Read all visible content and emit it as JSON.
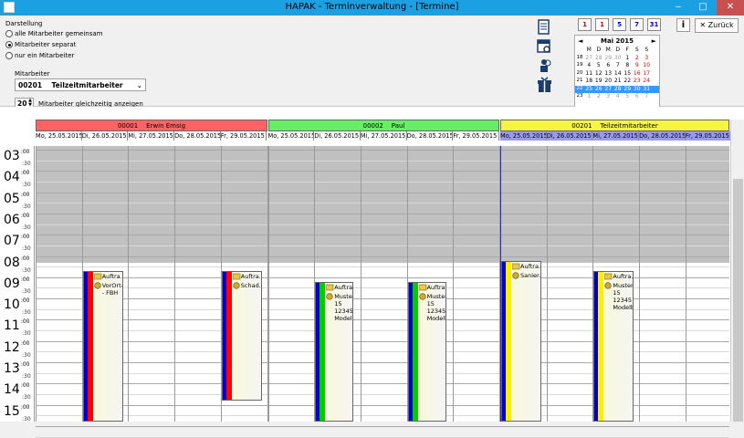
{
  "window": {
    "title": "HAPAK - Terminverwaltung - [Termine]",
    "min_glyph": "‒",
    "max_glyph": "□",
    "close_glyph": "✕"
  },
  "toolbar": {
    "darstellung_label": "Darstellung",
    "radio_options": [
      "alle Mitarbeiter gemeinsam",
      "Mitarbeiter separat",
      "nur ein Mitarbeiter"
    ],
    "selected_radio": 1,
    "mitarbeiter_label": "Mitarbeiter",
    "mitarbeiter_id": "00201",
    "mitarbeiter_name": "Teilzeitmitarbeiter",
    "count_value": "20",
    "count_label": "Mitarbeiter gleichzeitig anzeigen",
    "view_buttons": [
      "1",
      "1",
      "5",
      "7",
      "31"
    ],
    "help_label": "i",
    "back_label": "Zurück",
    "back_icon": "✕"
  },
  "calendar": {
    "month": "Mai 2015",
    "prev": "◄",
    "next": "►",
    "weekdays": [
      "M",
      "D",
      "M",
      "D",
      "F",
      "S",
      "S"
    ],
    "weeks": [
      {
        "wk": "18",
        "days": [
          "27",
          "28",
          "29",
          "30",
          "1",
          "2",
          "3"
        ]
      },
      {
        "wk": "19",
        "days": [
          "4",
          "5",
          "6",
          "7",
          "8",
          "9",
          "10"
        ]
      },
      {
        "wk": "20",
        "days": [
          "11",
          "12",
          "13",
          "14",
          "15",
          "16",
          "17"
        ]
      },
      {
        "wk": "21",
        "days": [
          "18",
          "19",
          "20",
          "21",
          "22",
          "23",
          "24"
        ]
      },
      {
        "wk": "22",
        "days": [
          "25",
          "26",
          "27",
          "28",
          "29",
          "30",
          "31"
        ]
      },
      {
        "wk": "23",
        "days": [
          "1",
          "2",
          "3",
          "4",
          "5",
          "6",
          "7"
        ]
      }
    ]
  },
  "employees": [
    {
      "id": "00001",
      "name": "Erwin Emsig",
      "color": "#ff6464"
    },
    {
      "id": "00002",
      "name": "Paul",
      "color": "#66ee66"
    },
    {
      "id": "00201",
      "name": "Teilzeitmitarbeiter",
      "color": "#f5f542"
    }
  ],
  "days": [
    "Mo, 25.05.2015",
    "Di, 26.05.2015",
    "Mi, 27.05.2015",
    "Do, 28.05.2015",
    "Fr, 29.05.2015"
  ],
  "hours": [
    "03",
    "04",
    "05",
    "06",
    "07",
    "08",
    "09",
    "10",
    "11",
    "12",
    "13",
    "14",
    "15"
  ],
  "half_label": ":30",
  "hour_sup": ":00",
  "appointments": [
    {
      "title": "Auftra...",
      "lines": [
        "VorOrt-Ei",
        "- FBH"
      ]
    },
    {
      "title": "Auftra...",
      "lines": [
        "Schad..."
      ]
    },
    {
      "title": "Auftra...",
      "lines": [
        "Musterga",
        "15",
        "12345",
        "Modelbe"
      ]
    },
    {
      "title": "Auftra...",
      "lines": [
        "Musterga",
        "15",
        "12345",
        "Modelbe"
      ]
    },
    {
      "title": "Auftra...",
      "lines": [
        "Sanier..."
      ]
    },
    {
      "title": "Auftra...",
      "lines": [
        "Musterga",
        "15",
        "12345",
        "Modelbe"
      ]
    }
  ],
  "colors": {
    "titlebar": "#1ba1e2",
    "emp1": "#ff0000",
    "emp2": "#00cc00",
    "emp3": "#ffee00",
    "blue": "#0000cc"
  }
}
